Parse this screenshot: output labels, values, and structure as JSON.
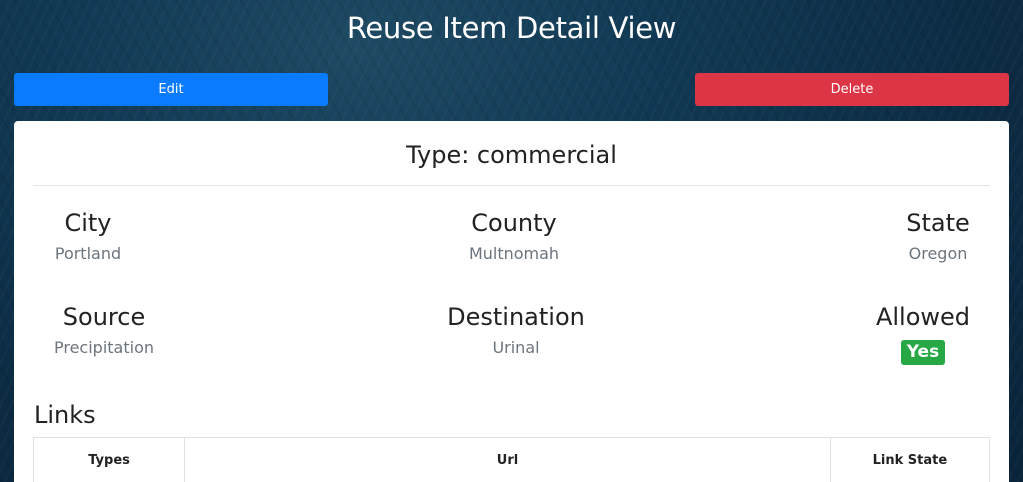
{
  "page": {
    "title": "Reuse Item Detail View"
  },
  "actions": {
    "edit_label": "Edit",
    "delete_label": "Delete"
  },
  "item": {
    "type_heading": "Type: commercial",
    "fields": {
      "city": {
        "label": "City",
        "value": "Portland"
      },
      "county": {
        "label": "County",
        "value": "Multnomah"
      },
      "state": {
        "label": "State",
        "value": "Oregon"
      },
      "source": {
        "label": "Source",
        "value": "Precipitation"
      },
      "destination": {
        "label": "Destination",
        "value": "Urinal"
      },
      "allowed": {
        "label": "Allowed",
        "value": "Yes"
      }
    }
  },
  "links": {
    "heading": "Links",
    "columns": [
      "Types",
      "Url",
      "Link State"
    ]
  },
  "colors": {
    "edit_button": "#0a7bff",
    "delete_button": "#dc3545",
    "allowed_badge": "#28a745"
  }
}
